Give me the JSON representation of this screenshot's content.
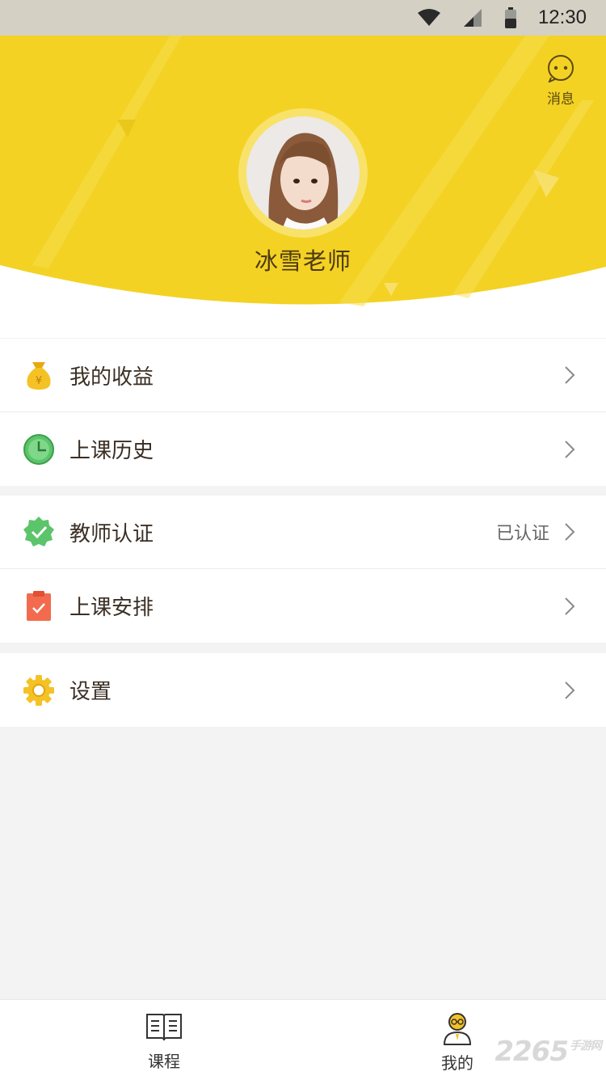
{
  "status_bar": {
    "time": "12:30"
  },
  "header": {
    "message_label": "消息",
    "username": "冰雪老师",
    "accent_color": "#f3d224"
  },
  "menu": {
    "group1": [
      {
        "label": "我的收益",
        "icon": "money-bag-icon"
      },
      {
        "label": "上课历史",
        "icon": "clock-icon"
      }
    ],
    "group2": [
      {
        "label": "教师认证",
        "icon": "verified-badge-icon",
        "status": "已认证"
      },
      {
        "label": "上课安排",
        "icon": "clipboard-icon"
      }
    ],
    "group3": [
      {
        "label": "设置",
        "icon": "gear-icon"
      }
    ]
  },
  "tabbar": {
    "tabs": [
      {
        "label": "课程",
        "icon": "book-icon"
      },
      {
        "label": "我的",
        "icon": "teacher-icon"
      }
    ]
  },
  "watermark": {
    "text": "2265",
    "suffix": "手游网"
  }
}
